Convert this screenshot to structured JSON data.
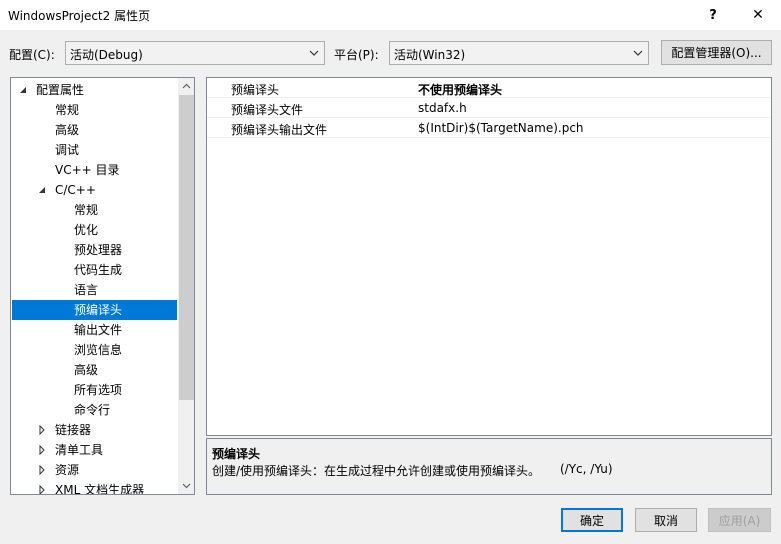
{
  "window": {
    "title": "WindowsProject2 属性页",
    "help_glyph": "?",
    "close_glyph": "✕"
  },
  "toolbar": {
    "config_label": "配置(C):",
    "config_value": "活动(Debug)",
    "platform_label": "平台(P):",
    "platform_value": "活动(Win32)",
    "config_manager_label": "配置管理器(O)..."
  },
  "tree": {
    "items": [
      {
        "label": "配置属性",
        "expander": "expanded"
      },
      {
        "label": "常规",
        "expander": "none"
      },
      {
        "label": "高级",
        "expander": "none"
      },
      {
        "label": "调试",
        "expander": "none"
      },
      {
        "label": "VC++ 目录",
        "expander": "none"
      },
      {
        "label": "C/C++",
        "expander": "expanded"
      },
      {
        "label": "常规",
        "expander": "none"
      },
      {
        "label": "优化",
        "expander": "none"
      },
      {
        "label": "预处理器",
        "expander": "none"
      },
      {
        "label": "代码生成",
        "expander": "none"
      },
      {
        "label": "语言",
        "expander": "none"
      },
      {
        "label": "预编译头",
        "expander": "none",
        "selected": true
      },
      {
        "label": "输出文件",
        "expander": "none"
      },
      {
        "label": "浏览信息",
        "expander": "none"
      },
      {
        "label": "高级",
        "expander": "none"
      },
      {
        "label": "所有选项",
        "expander": "none"
      },
      {
        "label": "命令行",
        "expander": "none"
      },
      {
        "label": "链接器",
        "expander": "collapsed"
      },
      {
        "label": "清单工具",
        "expander": "collapsed"
      },
      {
        "label": "资源",
        "expander": "collapsed"
      },
      {
        "label": "XML 文档生成器",
        "expander": "collapsed"
      }
    ]
  },
  "grid": {
    "rows": [
      {
        "name": "预编译头",
        "value": "不使用预编译头",
        "bold": true
      },
      {
        "name": "预编译头文件",
        "value": "stdafx.h",
        "bold": false
      },
      {
        "name": "预编译头输出文件",
        "value": "$(IntDir)$(TargetName).pch",
        "bold": false
      }
    ]
  },
  "description": {
    "title": "预编译头",
    "text": "创建/使用预编译头：在生成过程中允许创建或使用预编译头。",
    "switch": "(/Yc, /Yu)"
  },
  "buttons": {
    "ok": "确定",
    "cancel": "取消",
    "apply": "应用(A)"
  },
  "colors": {
    "selection": "#0078d7",
    "dialog_bg": "#f0f0f0"
  }
}
